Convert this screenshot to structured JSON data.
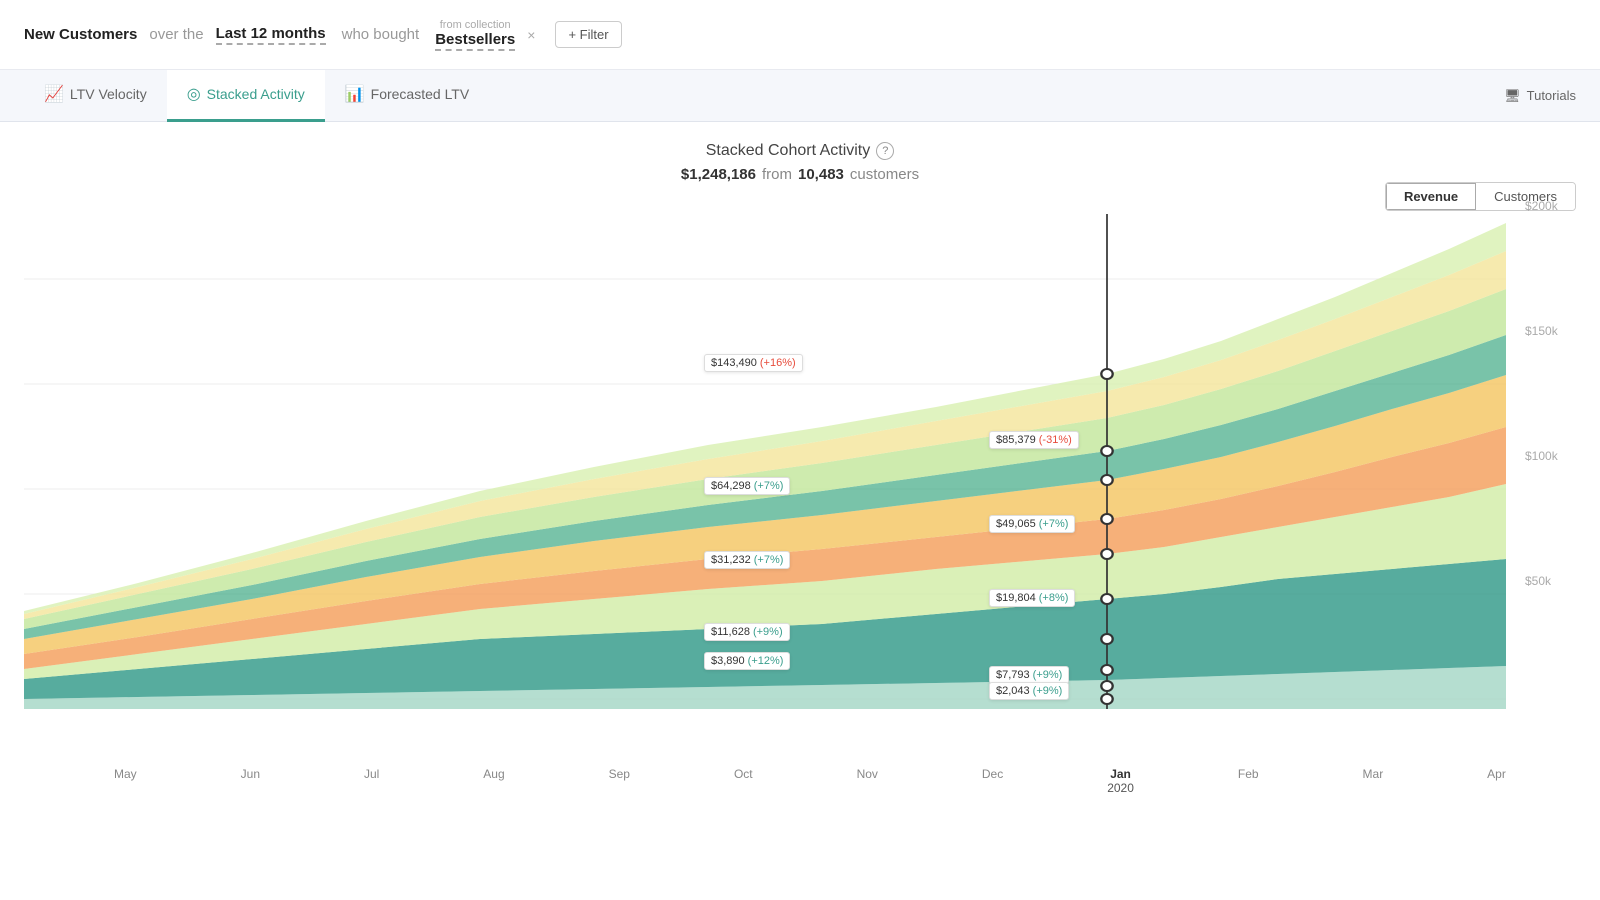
{
  "header": {
    "new_customers": "New Customers",
    "over_the": "over the",
    "last_12": "Last 12 months",
    "who_bought": "who bought",
    "collection_label": "from collection",
    "bestsellers": "Bestsellers",
    "close": "×",
    "filter": "+ Filter"
  },
  "tabs": [
    {
      "id": "ltv-velocity",
      "label": "LTV Velocity",
      "icon": "📈",
      "active": false
    },
    {
      "id": "stacked-activity",
      "label": "Stacked Activity",
      "icon": "◎",
      "active": true
    },
    {
      "id": "forecasted-ltv",
      "label": "Forecasted LTV",
      "icon": "📊",
      "active": false
    }
  ],
  "tutorials": "Tutorials",
  "chart": {
    "title": "Stacked Cohort Activity",
    "info_icon": "?",
    "subtitle": {
      "amount": "$1,248,186",
      "from": "from",
      "count": "10,483",
      "customers": "customers"
    },
    "view_toggle": {
      "revenue": "Revenue",
      "customers": "Customers",
      "active": "Revenue"
    },
    "y_axis": [
      "$200k",
      "$150k",
      "$100k",
      "$50k",
      ""
    ],
    "x_axis": [
      "May",
      "Jun",
      "Jul",
      "Aug",
      "Sep",
      "Oct",
      "Nov",
      "Dec",
      "Jan\n2020",
      "Feb",
      "Mar",
      "Apr"
    ],
    "tooltips": [
      {
        "value": "$143,490",
        "pct": "+16%",
        "pct_type": "pos",
        "color": "#c5e8a0"
      },
      {
        "value": "$85,379",
        "pct": "-31%",
        "pct_type": "neg",
        "color": "#f4a261"
      },
      {
        "value": "$64,298",
        "pct": "+7%",
        "pct_type": "pos",
        "color": "#f4c869"
      },
      {
        "value": "$49,065",
        "pct": "+7%",
        "pct_type": "pos",
        "color": "#4caf8c"
      },
      {
        "value": "$31,232",
        "pct": "+7%",
        "pct_type": "pos",
        "color": "#f4a261"
      },
      {
        "value": "$19,804",
        "pct": "+8%",
        "pct_type": "pos",
        "color": "#f4c869"
      },
      {
        "value": "$11,628",
        "pct": "+9%",
        "pct_type": "pos",
        "color": "#c5e8a0"
      },
      {
        "value": "$3,890",
        "pct": "+12%",
        "pct_type": "pos",
        "color": "#4caf8c"
      },
      {
        "value": "$7,793",
        "pct": "+9%",
        "pct_type": "pos",
        "color": "#cce0a0"
      },
      {
        "value": "$2,043",
        "pct": "+9%",
        "pct_type": "pos",
        "color": "#e0e0e0"
      }
    ]
  }
}
